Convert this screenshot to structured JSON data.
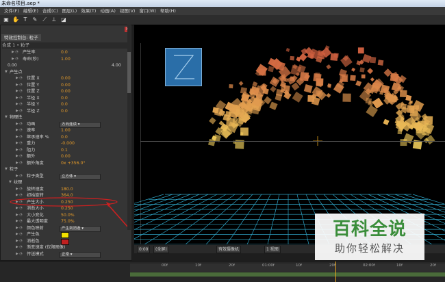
{
  "window": {
    "title": "未命名项目.aep *"
  },
  "menu": [
    "文件(F)",
    "编辑(E)",
    "合成(C)",
    "图层(L)",
    "效果(T)",
    "动画(A)",
    "视图(V)",
    "窗口(W)",
    "帮助(H)"
  ],
  "effects_panel": {
    "tab_label": "特效控制台: 粒子",
    "subtitle": "合成 1 • 粒子",
    "rows": [
      {
        "label": "产生率",
        "value": "0.0",
        "indent": 2,
        "type": "prop"
      },
      {
        "label": "寿命(秒)",
        "value": "1.00",
        "indent": 2,
        "type": "prop"
      },
      {
        "label": "0.00",
        "value": "4.00",
        "indent": 2,
        "type": "slider"
      },
      {
        "label": "产生点",
        "value": "",
        "indent": 0,
        "type": "group"
      },
      {
        "label": "位置 X",
        "value": "0.00",
        "indent": 3,
        "type": "prop"
      },
      {
        "label": "位置 Y",
        "value": "0.00",
        "indent": 3,
        "type": "prop"
      },
      {
        "label": "位置 Z",
        "value": "0.00",
        "indent": 3,
        "type": "prop"
      },
      {
        "label": "半径 X",
        "value": "0.0",
        "indent": 3,
        "type": "prop"
      },
      {
        "label": "半径 Y",
        "value": "0.0",
        "indent": 3,
        "type": "prop"
      },
      {
        "label": "半径 Z",
        "value": "0.0",
        "indent": 3,
        "type": "prop"
      },
      {
        "label": "物理性",
        "value": "",
        "indent": 0,
        "type": "group"
      },
      {
        "label": "动画",
        "value": "方向连读",
        "indent": 3,
        "type": "dropdown"
      },
      {
        "label": "速率",
        "value": "1.00",
        "indent": 3,
        "type": "prop"
      },
      {
        "label": "继承速率 %",
        "value": "0.0",
        "indent": 3,
        "type": "prop"
      },
      {
        "label": "重力",
        "value": "-0.000",
        "indent": 3,
        "type": "prop"
      },
      {
        "label": "阻力",
        "value": "0.1",
        "indent": 3,
        "type": "prop"
      },
      {
        "label": "额外",
        "value": "0.00",
        "indent": 3,
        "type": "prop"
      },
      {
        "label": "额外角度",
        "value": "0x +356.0°",
        "indent": 3,
        "type": "prop"
      },
      {
        "label": "粒子",
        "value": "",
        "indent": 0,
        "type": "group"
      },
      {
        "label": "粒子类型",
        "value": "立方体",
        "indent": 3,
        "type": "dropdown",
        "highlighted": true
      },
      {
        "label": "纹理",
        "value": "",
        "indent": 1,
        "type": "group"
      },
      {
        "label": "旋转速度",
        "value": "180.0",
        "indent": 3,
        "type": "prop"
      },
      {
        "label": "初始旋转",
        "value": "364.0",
        "indent": 3,
        "type": "prop"
      },
      {
        "label": "产生大小",
        "value": "0.250",
        "indent": 3,
        "type": "prop"
      },
      {
        "label": "消逝大小",
        "value": "0.250",
        "indent": 3,
        "type": "prop"
      },
      {
        "label": "大小变化",
        "value": "50.0%",
        "indent": 3,
        "type": "prop"
      },
      {
        "label": "最大透明度",
        "value": "75.0%",
        "indent": 3,
        "type": "prop"
      },
      {
        "label": "颜色映射",
        "value": "产生到消逝",
        "indent": 3,
        "type": "dropdown"
      },
      {
        "label": "产生色",
        "value": "",
        "indent": 3,
        "type": "color",
        "color": "#f0e000"
      },
      {
        "label": "消逝色",
        "value": "",
        "indent": 3,
        "type": "color",
        "color": "#c02020"
      },
      {
        "label": "渐变速度 (仅限图像)",
        "value": "",
        "indent": 3,
        "type": "prop"
      },
      {
        "label": "传送模式",
        "value": "正常",
        "indent": 3,
        "type": "dropdown"
      }
    ]
  },
  "viewer": {
    "logo_letter": "Z",
    "status": {
      "zoom": "(全屏)",
      "camera": "有效摄像机",
      "views": "1 视图"
    }
  },
  "timeline": {
    "ticks": [
      "00f",
      "10f",
      "20f",
      "01:00f",
      "10f",
      "20f",
      "02:00f",
      "10f",
      "20f"
    ]
  },
  "watermark": {
    "line1": "百科全说",
    "line2": "助你轻松解决"
  },
  "colors": {
    "particle_light": "#f4e060",
    "particle_dark": "#d06040",
    "grid": "#2fa6c8",
    "highlight": "#cc2020",
    "value": "#e39a2a"
  }
}
